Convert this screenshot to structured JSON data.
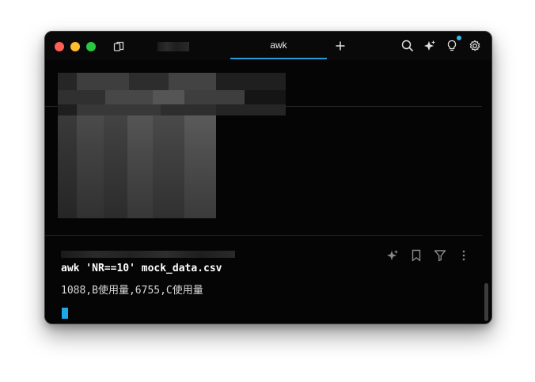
{
  "tab": {
    "active_label": "awk"
  },
  "icons": {
    "sidebar": "sidebar-icon",
    "new_tab": "plus-icon",
    "search": "search-icon",
    "ai": "sparkle-icon",
    "tips": "lightbulb-icon",
    "settings": "gear-icon",
    "block_ai": "sparkle-icon",
    "bookmark": "bookmark-icon",
    "filter": "filter-icon",
    "more": "more-vertical-icon"
  },
  "block": {
    "command": "awk 'NR==10' mock_data.csv",
    "output": "1088,B使用量,6755,C使用量"
  },
  "colors": {
    "accent": "#2a9bd8",
    "cursor": "#1ea8e8",
    "background": "#050505"
  }
}
